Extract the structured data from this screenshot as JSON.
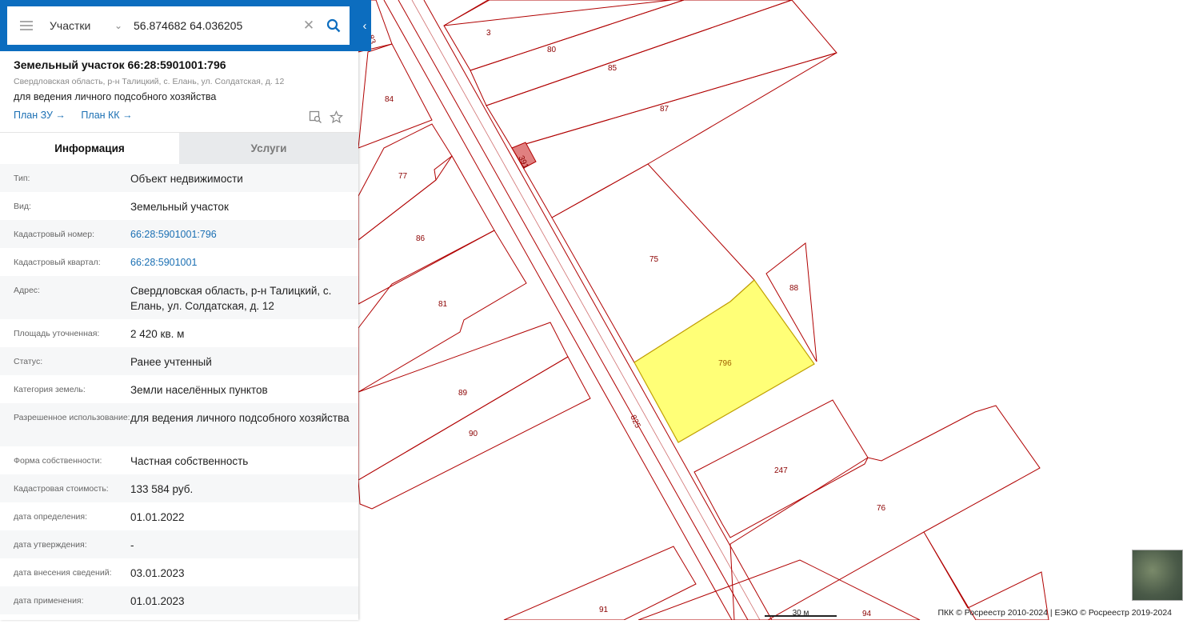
{
  "search": {
    "layer": "Участки",
    "coords": "56.874682 64.036205"
  },
  "parcel": {
    "title": "Земельный участок 66:28:5901001:796",
    "address_short": "Свердловская область, р-н Талицкий, с. Елань, ул. Солдатская, д. 12",
    "purpose": "для ведения личного подсобного хозяйства",
    "link_plan_zu": "План ЗУ →",
    "link_plan_kk": "План КК →"
  },
  "tabs": {
    "info": "Информация",
    "services": "Услуги"
  },
  "rows": [
    {
      "label": "Тип:",
      "value": "Объект недвижимости"
    },
    {
      "label": "Вид:",
      "value": "Земельный участок"
    },
    {
      "label": "Кадастровый номер:",
      "value": "66:28:5901001:796"
    },
    {
      "label": "Кадастровый квартал:",
      "value": "66:28:5901001"
    },
    {
      "label": "Адрес:",
      "value": "Свердловская область, р-н Талицкий, с. Елань, ул. Солдатская, д. 12"
    },
    {
      "label": "Площадь уточненная:",
      "value": "2 420 кв. м"
    },
    {
      "label": "Статус:",
      "value": "Ранее учтенный"
    },
    {
      "label": "Категория земель:",
      "value": "Земли населённых пунктов"
    },
    {
      "label": "Разрешенное использование:",
      "value": "для ведения личного подсобного хозяйства"
    },
    {
      "label": "Форма собственности:",
      "value": "Частная собственность"
    },
    {
      "label": "Кадастровая стоимость:",
      "value": "133 584 руб."
    },
    {
      "label": "дата определения:",
      "value": "01.01.2022"
    },
    {
      "label": "дата утверждения:",
      "value": "-"
    },
    {
      "label": "дата внесения сведений:",
      "value": "03.01.2023"
    },
    {
      "label": "дата применения:",
      "value": "01.01.2023"
    }
  ],
  "map": {
    "parcel_labels": [
      "83",
      "3",
      "80",
      "85",
      "84",
      "87",
      "391",
      "77",
      "86",
      "75",
      "88",
      "81",
      "796",
      "89",
      "825",
      "90",
      "247",
      "76",
      "91",
      "94"
    ],
    "scale": "30 м",
    "attribution": "ПКК © Росреестр 2010-2024 | ЕЭКО © Росреестр 2019-2024"
  },
  "colors": {
    "header_blue": "#0c6dbf",
    "boundary": "#b00000",
    "selected_fill": "#ffff77",
    "link": "#1a6fb3"
  }
}
